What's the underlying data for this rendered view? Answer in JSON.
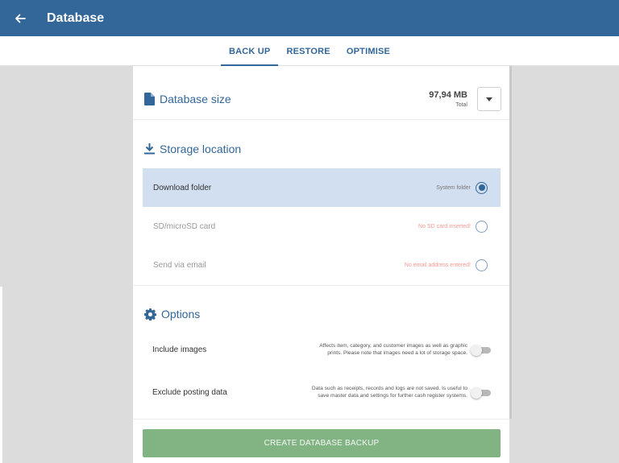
{
  "appbar": {
    "title": "Database"
  },
  "tabs": [
    {
      "label": "BACK UP",
      "active": true
    },
    {
      "label": "RESTORE",
      "active": false
    },
    {
      "label": "OPTIMISE",
      "active": false
    }
  ],
  "database_size": {
    "title": "Database size",
    "value": "97,94 MB",
    "sub": "Total"
  },
  "storage": {
    "title": "Storage location",
    "options": [
      {
        "label": "Download folder",
        "note": "System folder",
        "selected": true
      },
      {
        "label": "SD/microSD card",
        "note": "No SD card inserted!",
        "selected": false
      },
      {
        "label": "Send via email",
        "note": "No email address entered!",
        "selected": false
      }
    ]
  },
  "options": {
    "title": "Options",
    "items": [
      {
        "label": "Include images",
        "desc": "Affects item, category, and customer images as well as graphic prints. Please note that images need a lot of storage space.",
        "enabled": false
      },
      {
        "label": "Exclude posting data",
        "desc": "Data such as receipts, records and logs are not saved. Is useful to save master data and settings for further cash register systems.",
        "enabled": false
      }
    ]
  },
  "create_button": {
    "label": "CREATE DATABASE BACKUP"
  },
  "colors": {
    "primary": "#336699",
    "selected_row": "#d1dff0",
    "create_button": "#82b383",
    "warning_text": "#f29a93"
  }
}
